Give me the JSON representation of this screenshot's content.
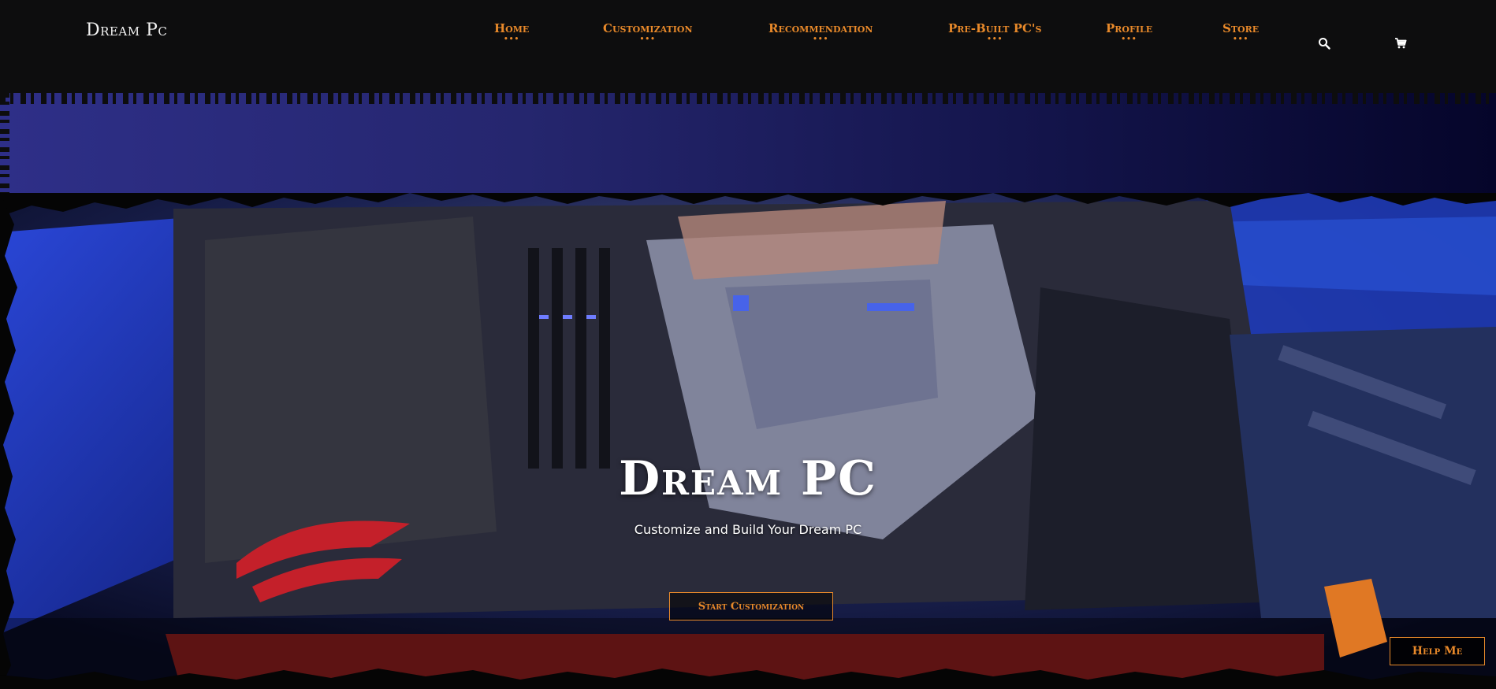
{
  "header": {
    "brand": "Dream Pc",
    "nav": [
      {
        "label": "Home"
      },
      {
        "label": "Customization"
      },
      {
        "label": "Recommendation"
      },
      {
        "label": "Pre-Built PC's"
      },
      {
        "label": "Profile"
      },
      {
        "label": "Store"
      }
    ],
    "nav_dots": "•••",
    "icons": [
      "search-icon",
      "cart-icon"
    ]
  },
  "hero": {
    "title": "Dream PC",
    "subtitle": "Customize and Build Your Dream PC",
    "cta_label": "Start Customization",
    "help_label": "Help Me"
  },
  "colors": {
    "accent": "#e8892a",
    "navbar": "#0d0d0e",
    "banner_start": "#2e2f88",
    "banner_end": "#05052a"
  }
}
